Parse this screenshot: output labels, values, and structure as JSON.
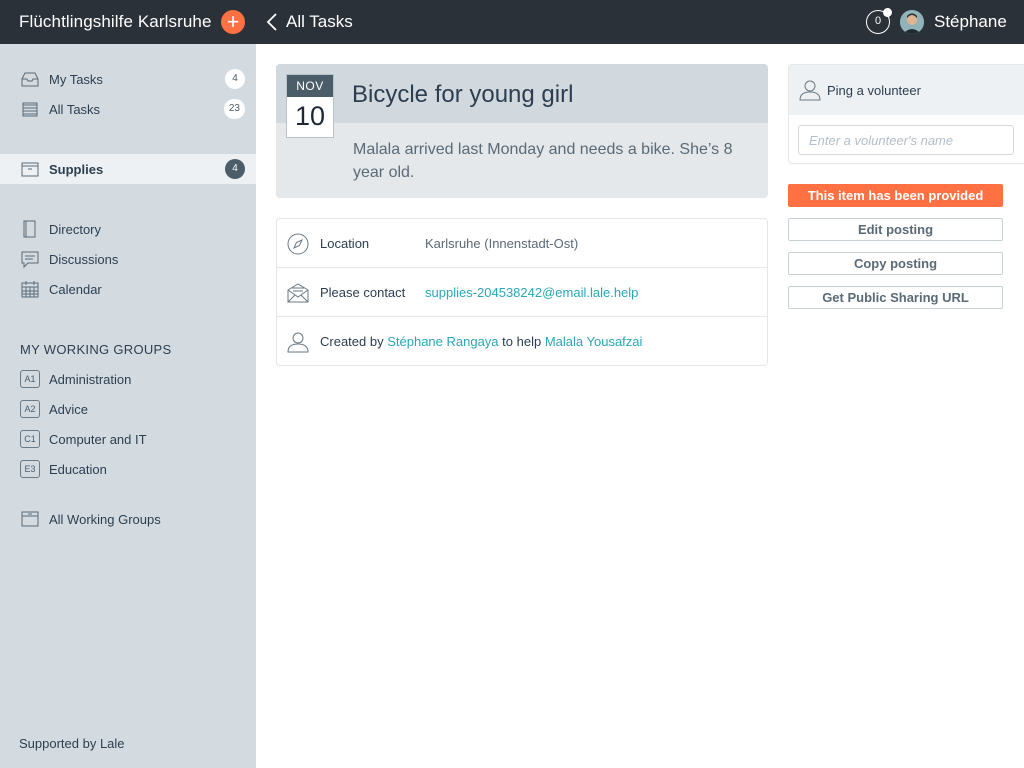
{
  "topbar": {
    "org_name": "Flüchtlingshilfe Karlsruhe",
    "add_label": "+",
    "back_label": "All Tasks",
    "notification_count": "0",
    "user_name": "Stéphane"
  },
  "sidebar": {
    "tasks": [
      {
        "label": "My Tasks",
        "count": "4",
        "icon": "inbox-icon"
      },
      {
        "label": "All Tasks",
        "count": "23",
        "icon": "stack-icon"
      }
    ],
    "categories": [
      {
        "label": "Supplies",
        "count": "4",
        "icon": "box-icon",
        "active": true
      }
    ],
    "tools": [
      {
        "label": "Directory",
        "icon": "book-icon"
      },
      {
        "label": "Discussions",
        "icon": "chat-icon"
      },
      {
        "label": "Calendar",
        "icon": "calendar-icon"
      }
    ],
    "groups_title": "MY WORKING GROUPS",
    "groups": [
      {
        "tag": "A1",
        "label": "Administration"
      },
      {
        "tag": "A2",
        "label": "Advice"
      },
      {
        "tag": "C1",
        "label": "Computer and IT"
      },
      {
        "tag": "E3",
        "label": "Education"
      }
    ],
    "all_groups_label": "All Working Groups",
    "footer": "Supported by Lale"
  },
  "task": {
    "month": "NOV",
    "day": "10",
    "title": "Bicycle for young girl",
    "description": "Malala arrived last Monday and needs a bike. She’s 8 year old."
  },
  "details": {
    "location_label": "Location",
    "location_value": "Karlsruhe (Innenstadt-Ost)",
    "contact_label": "Please contact",
    "contact_email": "supplies-204538242@email.lale.help",
    "created_prefix": "Created by",
    "created_by": "Stéphane Rangaya",
    "help_text": "to help",
    "help_for": "Malala Yousafzai"
  },
  "ping": {
    "title": "Ping a volunteer",
    "placeholder": "Enter a volunteer's name"
  },
  "actions": {
    "provided": "This item has been provided",
    "edit": "Edit posting",
    "copy": "Copy posting",
    "share": "Get Public Sharing URL"
  },
  "colors": {
    "topbar": "#2b3138",
    "sidebar": "#d3dbe1",
    "accent": "#ff7043",
    "link": "#2aa7b8"
  }
}
